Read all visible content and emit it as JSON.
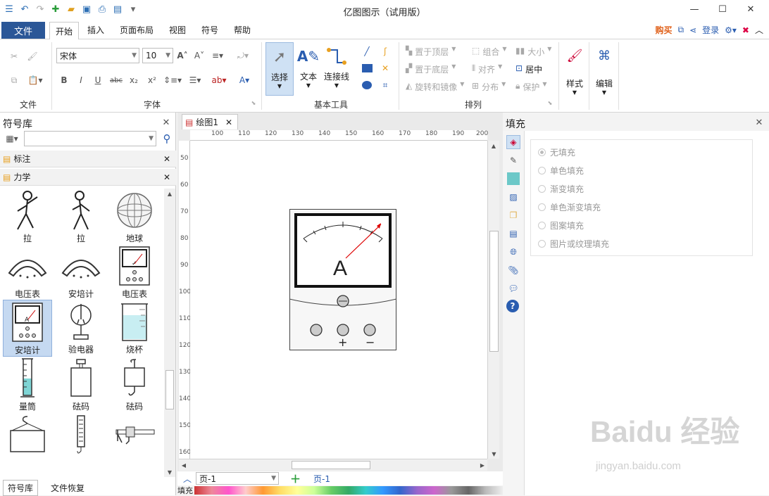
{
  "app": {
    "title": "亿图图示（试用版）"
  },
  "menu": {
    "file": "文件",
    "tabs": [
      "开始",
      "插入",
      "页面布局",
      "视图",
      "符号",
      "帮助"
    ],
    "buy": "购买",
    "login": "登录"
  },
  "ribbon": {
    "groups": {
      "file": "文件",
      "font": "字体",
      "basic_tools": "基本工具",
      "arrange": "排列"
    },
    "font_name": "宋体",
    "font_size": "10",
    "tools": {
      "select": "选择",
      "text": "文本",
      "connector": "连接线"
    },
    "arrange": {
      "bring_front": "置于顶层",
      "send_back": "置于底层",
      "rotate_mirror": "旋转和镜像",
      "group": "组合",
      "align": "对齐",
      "distribute": "分布",
      "size": "大小",
      "center": "居中",
      "protect": "保护"
    },
    "style": "样式",
    "edit": "编辑"
  },
  "library": {
    "title": "符号库",
    "sections": [
      "标注",
      "力学"
    ],
    "symbols": [
      {
        "label": "拉"
      },
      {
        "label": "拉"
      },
      {
        "label": "地球"
      },
      {
        "label": "电压表"
      },
      {
        "label": "安培计"
      },
      {
        "label": "电压表"
      },
      {
        "label": "安培计"
      },
      {
        "label": "验电器"
      },
      {
        "label": "烧杯"
      },
      {
        "label": "量筒"
      },
      {
        "label": "砝码"
      },
      {
        "label": "砝码"
      }
    ],
    "bottom_tabs": [
      "符号库",
      "文件恢复"
    ]
  },
  "document": {
    "tab": "绘图1",
    "ruler_h": [
      "100",
      "110",
      "120",
      "130",
      "140",
      "150",
      "160",
      "170",
      "180",
      "190",
      "200"
    ],
    "ruler_v": [
      "50",
      "60",
      "70",
      "80",
      "90",
      "100",
      "110",
      "120",
      "130",
      "140",
      "150",
      "160"
    ],
    "meter_letter": "A",
    "plus": "+",
    "minus": "−",
    "page_select": "页-1",
    "page_tab": "页-1",
    "fill_label": "填充"
  },
  "fill_panel": {
    "title": "填充",
    "options": [
      "无填充",
      "单色填充",
      "渐变填充",
      "单色渐变填充",
      "图案填充",
      "图片或纹理填充"
    ],
    "selected": "无填充"
  },
  "watermark": {
    "main": "Baidu 经验",
    "sub": "jingyan.baidu.com"
  },
  "colors": {
    "accent": "#2b5797",
    "buy": "#e0611a",
    "selected_bg": "#c5d9f1"
  }
}
